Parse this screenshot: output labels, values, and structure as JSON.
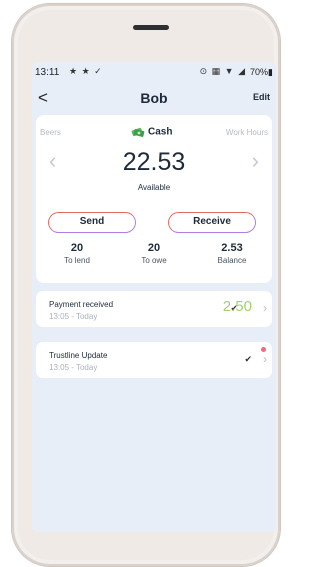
{
  "status_bar": {
    "time": "13:11",
    "left_icons": "★ ★ ✓",
    "right_icons": "⊙ ▦ ▼ ◢",
    "battery": "70%▮"
  },
  "nav": {
    "back_glyph": "<",
    "title": "Bob",
    "edit_label": "Edit"
  },
  "wallet": {
    "prev_currency": "Beers",
    "currency": "Cash",
    "next_currency": "Work Hours",
    "prev_chevron": "‹",
    "next_chevron": "›",
    "amount": "22.53",
    "amount_label": "Available",
    "send_label": "Send",
    "receive_label": "Receive",
    "stats": [
      {
        "value": "20",
        "label": "To lend"
      },
      {
        "value": "20",
        "label": "To owe"
      },
      {
        "value": "2.53",
        "label": "Balance"
      }
    ]
  },
  "transactions": [
    {
      "title": "Payment received",
      "time": "13:05 - Today",
      "check": "✔",
      "amount": "2.50",
      "chevron": "›"
    },
    {
      "title": "Trustline Update",
      "time": "13:05 - Today",
      "check": "✔",
      "amount": "",
      "chevron": "›"
    }
  ],
  "colors": {
    "screen_bg": "#e8eef8",
    "accent_green": "#a4d06a",
    "notification_dot": "#f06b7b",
    "button_border_a": "#e06a5f",
    "button_border_b": "#b07ee0"
  }
}
